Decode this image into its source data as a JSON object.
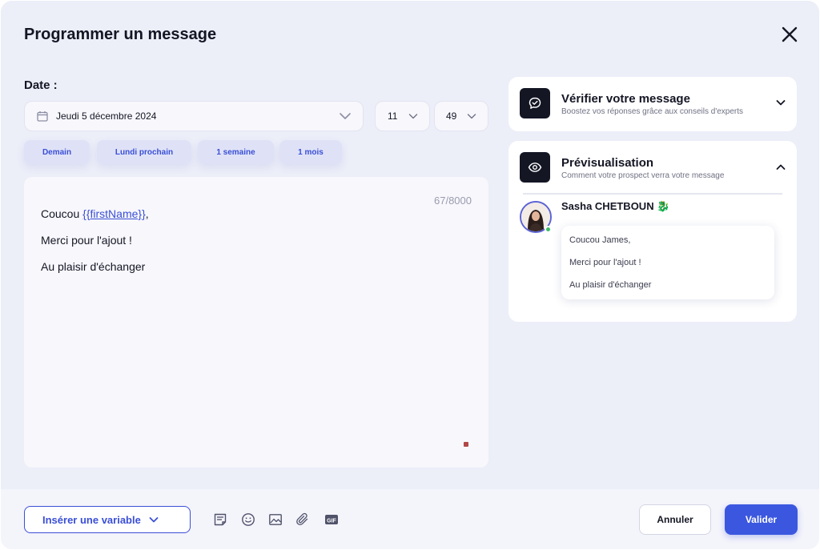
{
  "header": {
    "title": "Programmer un message",
    "close_icon": "close-icon"
  },
  "schedule": {
    "date_label": "Date :",
    "date_value": "Jeudi 5 décembre 2024",
    "hour_value": "11",
    "minute_value": "49",
    "quick_options": [
      "Demain",
      "Lundi prochain",
      "1 semaine",
      "1 mois"
    ]
  },
  "editor": {
    "char_count": "67/8000",
    "line1_prefix": "Coucou ",
    "line1_variable": "{{firstName}}",
    "line1_suffix": ",",
    "line2": "Merci pour l'ajout !",
    "line3": "Au plaisir d'échanger"
  },
  "verify_card": {
    "title": "Vérifier votre message",
    "subtitle": "Boostez vos réponses grâce aux conseils d'experts",
    "icon": "chat-check-icon"
  },
  "preview_card": {
    "title": "Prévisualisation",
    "subtitle": "Comment votre prospect verra votre message",
    "icon": "eye-icon",
    "sender_name": "Sasha CHETBOUN",
    "sender_emoji": "🐉",
    "message_lines": [
      "Coucou James,",
      "Merci pour l'ajout !",
      "Au plaisir d'échanger"
    ]
  },
  "footer": {
    "insert_variable_label": "Insérer une variable",
    "tools": [
      "template-icon",
      "emoji-icon",
      "image-icon",
      "attachment-icon",
      "gif-icon"
    ],
    "gif_label": "GIF",
    "cancel_label": "Annuler",
    "validate_label": "Valider"
  },
  "colors": {
    "accent": "#3b57df",
    "background": "#eceef8",
    "dark": "#141624"
  }
}
